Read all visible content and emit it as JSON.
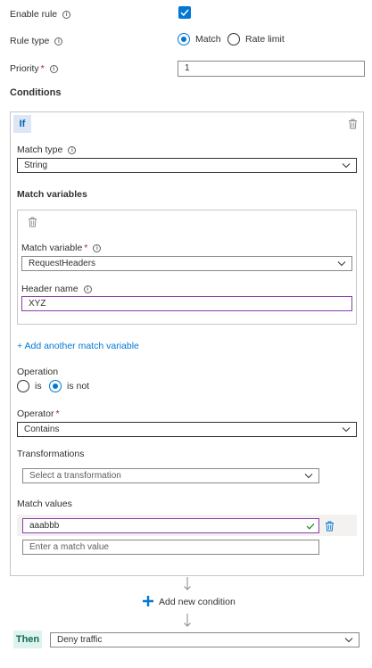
{
  "rule": {
    "enable_label": "Enable rule",
    "enable_checked": true,
    "type_label": "Rule type",
    "type_options": [
      "Match",
      "Rate limit"
    ],
    "type_selected": "Match",
    "priority_label": "Priority",
    "priority_value": "1"
  },
  "conditions": {
    "title": "Conditions",
    "if_tag": "If",
    "match_type_label": "Match type",
    "match_type_value": "String",
    "match_variables_title": "Match variables",
    "match_variable_label": "Match variable",
    "match_variable_value": "RequestHeaders",
    "header_name_label": "Header name",
    "header_name_value": "XYZ",
    "add_match_variable": "+ Add another match variable",
    "operation_label": "Operation",
    "operation_options": [
      "is",
      "is not"
    ],
    "operation_selected": "is not",
    "operator_label": "Operator",
    "operator_value": "Contains",
    "transformations_label": "Transformations",
    "transformations_placeholder": "Select a transformation",
    "match_values_label": "Match values",
    "match_value_1": "aaabbb",
    "match_value_placeholder": "Enter a match value"
  },
  "add_condition": "Add new condition",
  "then": {
    "tag": "Then",
    "action_value": "Deny traffic"
  },
  "colors": {
    "accent": "#0078d4",
    "required": "#a4262c",
    "focus_border": "#8a3ea6",
    "valid_check": "#107c10"
  }
}
